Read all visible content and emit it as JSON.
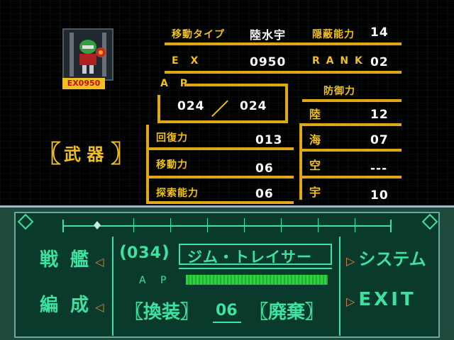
{
  "unit": {
    "ex_badge": "EX0950",
    "move_type_label": "移動タイプ",
    "move_type_value": "陸水宇",
    "stealth_label": "隠蔽能力",
    "stealth_value": "14",
    "ex_label": "E X",
    "ex_value": "0950",
    "rank_label": "R A N K",
    "rank_value": "02",
    "ap_label": "A P",
    "ap_current": "024",
    "ap_max": "024",
    "ap_sep": "／",
    "defense_label": "防御力",
    "defense": [
      {
        "label": "陸",
        "value": "12"
      },
      {
        "label": "海",
        "value": "07"
      },
      {
        "label": "空",
        "value": "---"
      },
      {
        "label": "宇",
        "value": "10"
      }
    ],
    "weapons_label": "武 器",
    "recover_label": "回復力",
    "recover_value": "013",
    "mobility_label": "移動力",
    "mobility_value": "06",
    "search_label": "探索能力",
    "search_value": "06"
  },
  "menu": {
    "warship": "戦 艦",
    "formation": "編 成",
    "unit_no": "034",
    "unit_name": "ジム・トレイサー",
    "ap_label": "A P",
    "ap_fraction": 1.0,
    "equip": "換装",
    "count": "06",
    "discard": "廃棄",
    "system": "システム",
    "exit": "EXIT"
  },
  "colors": {
    "accent_yellow": "#e0a818",
    "menu_green": "#40e0a0",
    "ap_bar": "#30d040"
  }
}
